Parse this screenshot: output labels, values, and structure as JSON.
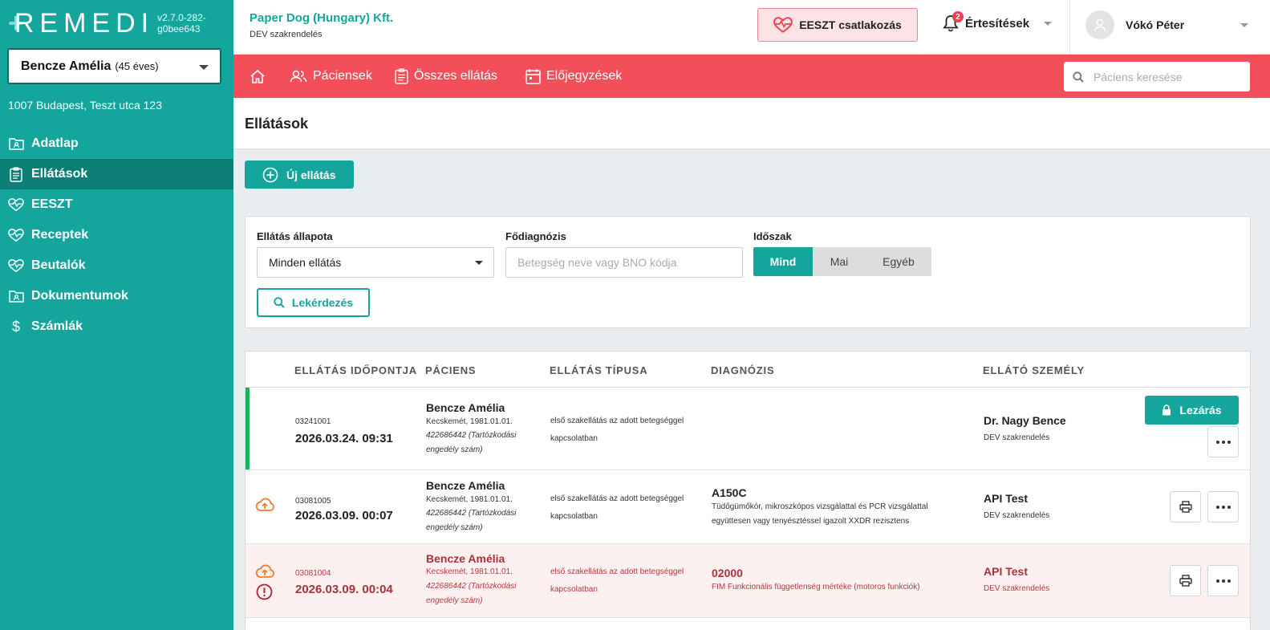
{
  "app": {
    "logo": "REMEDI",
    "version": "v2.7.0-282-g0bee643"
  },
  "sidebar": {
    "patient_name": "Bencze Amélia",
    "patient_age": "(45 éves)",
    "address": "1007 Budapest, Teszt utca 123",
    "items": [
      {
        "label": "Adatlap",
        "icon": "folder-user-icon",
        "active": false
      },
      {
        "label": "Ellátások",
        "icon": "clipboard-icon",
        "active": true
      },
      {
        "label": "EESZT",
        "icon": "eeszt-heart-icon",
        "active": false
      },
      {
        "label": "Receptek",
        "icon": "eeszt-heart-icon",
        "active": false
      },
      {
        "label": "Beutalók",
        "icon": "eeszt-heart-icon",
        "active": false
      },
      {
        "label": "Dokumentumok",
        "icon": "folder-user-icon",
        "active": false
      },
      {
        "label": "Számlák",
        "icon": "dollar-icon",
        "active": false
      }
    ]
  },
  "topbar": {
    "org_name": "Paper Dog (Hungary) Kft.",
    "org_sub": "DEV szakrendelés",
    "eeszt_button": "EESZT csatlakozás",
    "notifications_label": "Értesítések",
    "notifications_count": "2",
    "user_name": "Vókó Péter"
  },
  "mainnav": {
    "items": [
      "Páciensek",
      "Összes ellátás",
      "Előjegyzések"
    ],
    "search_placeholder": "Páciens keresése"
  },
  "page": {
    "title": "Ellátások",
    "new_button": "Új ellátás"
  },
  "filter": {
    "status_label": "Ellátás állapota",
    "status_value": "Minden ellátás",
    "diagnosis_label": "Fődiagnózis",
    "diagnosis_placeholder": "Betegség neve vagy BNO kódja",
    "period_label": "Időszak",
    "period_options": [
      "Mind",
      "Mai",
      "Egyéb"
    ],
    "query_button": "Lekérdezés"
  },
  "table": {
    "headers": [
      "ELLÁTÁS IDŐPONTJA",
      "PÁCIENS",
      "ELLÁTÁS TÍPUSA",
      "DIAGNÓZIS",
      "ELLÁTÓ SZEMÉLY"
    ],
    "lock_button": "Lezárás",
    "rows": [
      {
        "code": "03241001",
        "datetime": "2026.03.24. 09:31",
        "patient": "Bencze Amélia",
        "birth": "Kecskemét, 1981.01.01.",
        "id": "422686442 (Tartózkodási engedély szám)",
        "type": "első szakellátás az adott betegséggel kapcsolatban",
        "diag_code": "",
        "diag_desc": "",
        "provider": "Dr. Nagy Bence",
        "provider_sub": "DEV szakrendelés",
        "state": "open"
      },
      {
        "code": "03081005",
        "datetime": "2026.03.09. 00:07",
        "patient": "Bencze Amélia",
        "birth": "Kecskemét, 1981.01.01.",
        "id": "422686442 (Tartózkodási engedély szám)",
        "type": "első szakellátás az adott betegséggel kapcsolatban",
        "diag_code": "A150C",
        "diag_desc": "Tüdőgümőkór, mikroszkópos vizsgálattal és PCR vizsgálattal együttesen vagy tenyésztéssel igazolt XXDR rezisztens",
        "provider": "API Test",
        "provider_sub": "DEV szakrendelés",
        "state": "uploaded"
      },
      {
        "code": "03081004",
        "datetime": "2026.03.09. 00:04",
        "patient": "Bencze Amélia",
        "birth": "Kecskemét, 1981.01.01.",
        "id": "422686442 (Tartózkodási engedély szám)",
        "type": "első szakellátás az adott betegséggel kapcsolatban",
        "diag_code": "02000",
        "diag_desc": "FIM Funkcionális függetlenség mértéke (motoros funkciók)",
        "provider": "API Test",
        "provider_sub": "DEV szakrendelés",
        "state": "error"
      }
    ]
  },
  "colors": {
    "brand": "#14a59c",
    "nav_red": "#f24f5b",
    "error_text": "#a8323a",
    "upload_orange": "#f07a2c"
  }
}
